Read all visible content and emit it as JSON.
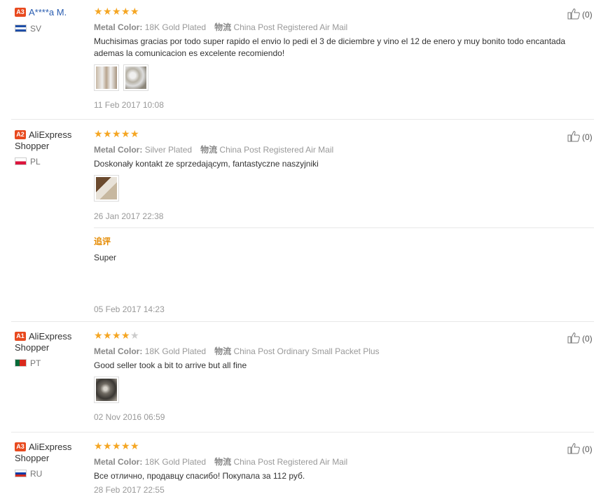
{
  "reviews": [
    {
      "level": "A3",
      "name": "A****a M.",
      "name_is_link": true,
      "country": "SV",
      "rating": 5,
      "metal_label": "Metal Color:",
      "metal_value": "18K Gold Plated",
      "logistics_label": "物流",
      "logistics_value": "China Post Registered Air Mail",
      "text": "Muchisimas gracias por todo super rapido el envio lo pedi el 3 de diciembre y vino el 12 de enero y muy bonito todo encantada ademas la comunicacion es excelente recomiendo!",
      "date": "11 Feb 2017 10:08",
      "likes": "(0)"
    },
    {
      "level": "A2",
      "name": "AliExpress Shopper",
      "country": "PL",
      "rating": 5,
      "metal_label": "Metal Color:",
      "metal_value": "Silver Plated",
      "logistics_label": "物流",
      "logistics_value": "China Post Registered Air Mail",
      "text": "Doskonały kontakt ze sprzedającym, fantastyczne naszyjniki",
      "date": "26 Jan 2017 22:38",
      "followup_label": "追评",
      "followup_text": "Super",
      "followup_date": "05 Feb 2017 14:23",
      "likes": "(0)"
    },
    {
      "level": "A1",
      "name": "AliExpress Shopper",
      "country": "PT",
      "rating": 4,
      "metal_label": "Metal Color:",
      "metal_value": "18K Gold Plated",
      "logistics_label": "物流",
      "logistics_value": "China Post Ordinary Small Packet Plus",
      "text": "Good seller took a bit to arrive but all fine",
      "date": "02 Nov 2016 06:59",
      "likes": "(0)"
    },
    {
      "level": "A3",
      "name": "AliExpress Shopper",
      "country": "RU",
      "rating": 5,
      "metal_label": "Metal Color:",
      "metal_value": "18K Gold Plated",
      "logistics_label": "物流",
      "logistics_value": "China Post Registered Air Mail",
      "text": "Все отлично, продавцу спасибо! Покупала за 112 руб.",
      "date": "28 Feb 2017 22:55",
      "likes": "(0)"
    }
  ],
  "colors": {
    "level_badge": "#e84a1f",
    "star_on": "#f5a623",
    "star_off": "#cccccc",
    "link": "#2a5db0",
    "followup": "#e58a00"
  }
}
